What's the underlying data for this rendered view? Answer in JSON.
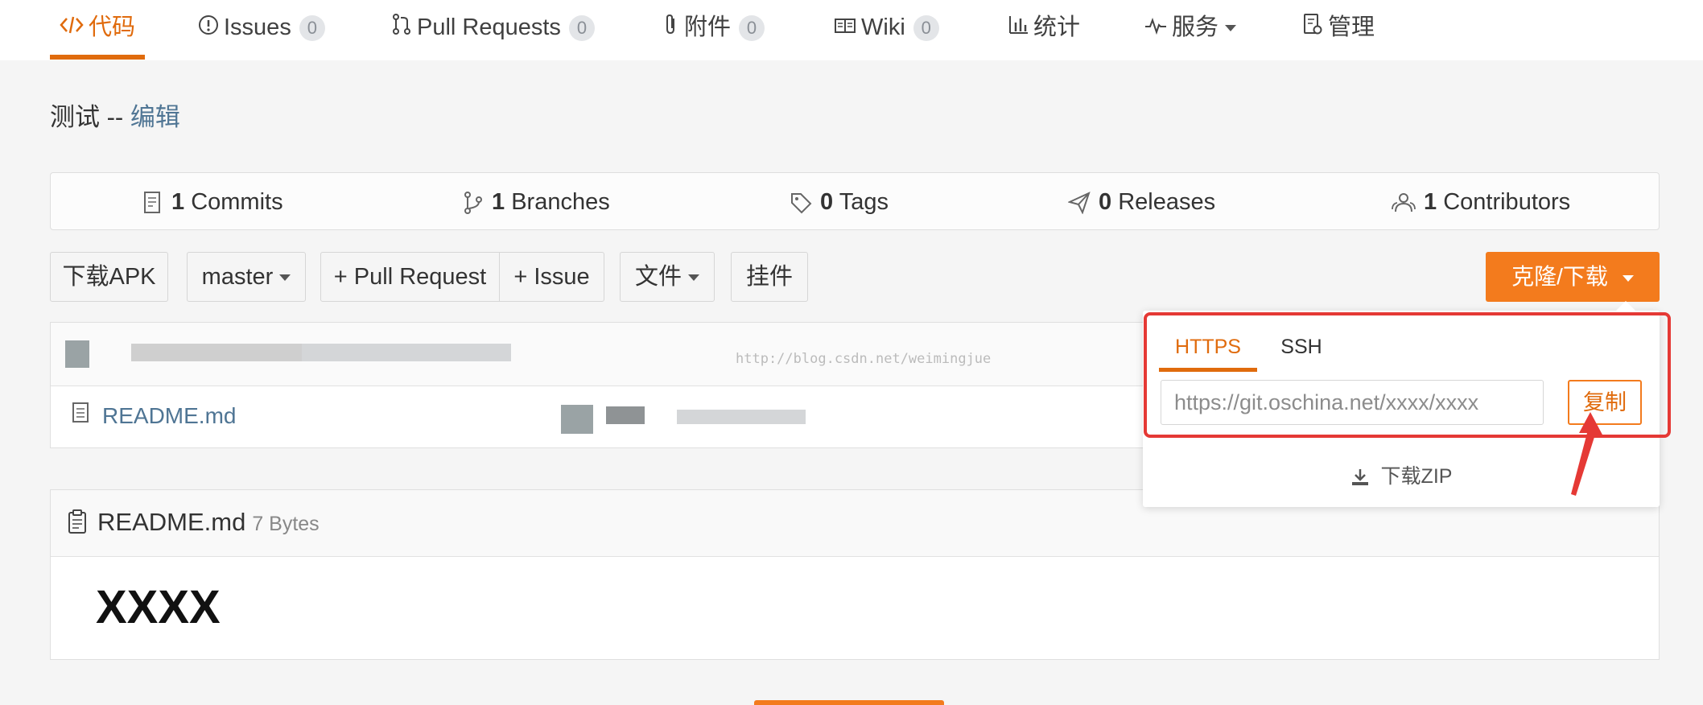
{
  "nav": {
    "code": "代码",
    "issues": "Issues",
    "issues_count": "0",
    "pulls": "Pull Requests",
    "pulls_count": "0",
    "attachments": "附件",
    "attachments_count": "0",
    "wiki": "Wiki",
    "wiki_count": "0",
    "stats": "统计",
    "services": "服务",
    "admin": "管理"
  },
  "page": {
    "title": "测试 -- ",
    "edit_link": "编辑"
  },
  "stats": {
    "commits_num": "1",
    "commits_label": "Commits",
    "branches_num": "1",
    "branches_label": "Branches",
    "tags_num": "0",
    "tags_label": "Tags",
    "releases_num": "0",
    "releases_label": "Releases",
    "contributors_num": "1",
    "contributors_label": "Contributors"
  },
  "toolbar": {
    "download_apk": "下载APK",
    "branch": "master",
    "pull_request": "+ Pull Request",
    "issue": "+ Issue",
    "files": "文件",
    "plugins": "挂件",
    "clone": "克隆/下载"
  },
  "files": [
    {
      "name": "README.md"
    }
  ],
  "watermark": "http://blog.csdn.net/weimingjue",
  "clone_panel": {
    "tab_https": "HTTPS",
    "tab_ssh": "SSH",
    "url": "https://git.oschina.net/xxxx/xxxx",
    "copy": "复制",
    "download_zip": "下载ZIP"
  },
  "readme": {
    "title": "README.md",
    "size": "7 Bytes",
    "content": "XXXX"
  },
  "colors": {
    "accent": "#f37b1d",
    "highlight": "#e53935",
    "link": "#4f7594"
  }
}
